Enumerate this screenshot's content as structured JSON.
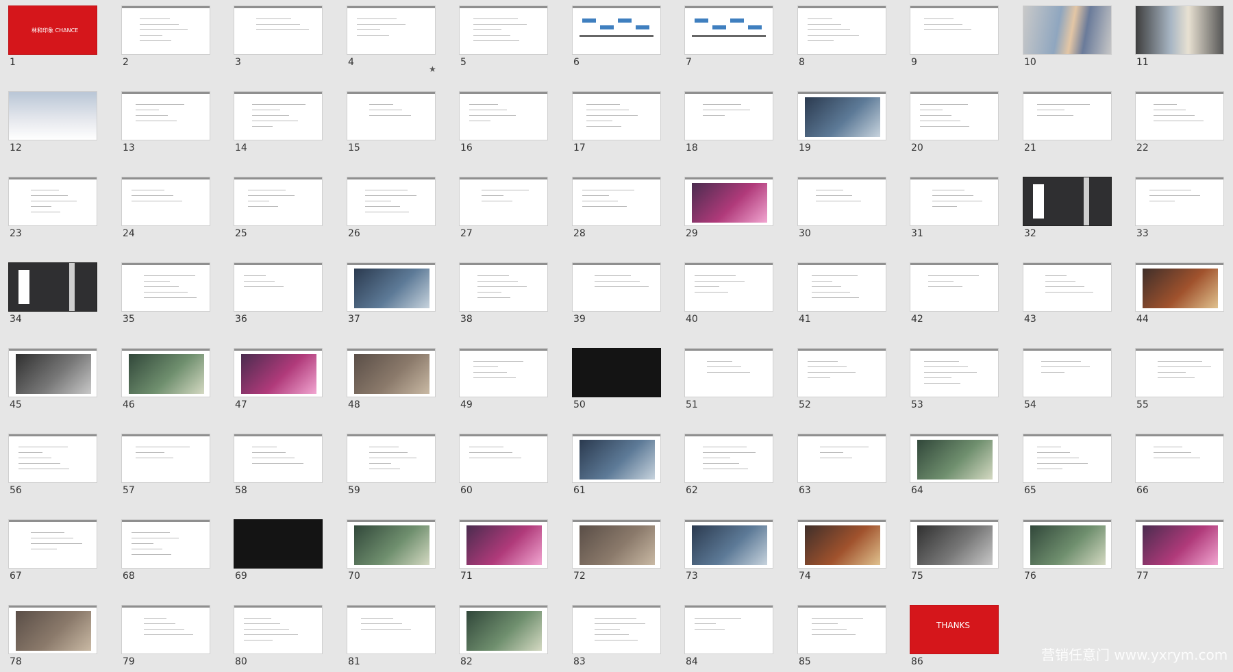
{
  "slides": [
    {
      "n": "1",
      "style": "red",
      "text": "林和印象 CHANCE"
    },
    {
      "n": "2",
      "style": "plain"
    },
    {
      "n": "3",
      "style": "plain"
    },
    {
      "n": "4",
      "style": "plain",
      "starred": true
    },
    {
      "n": "5",
      "style": "plain"
    },
    {
      "n": "6",
      "style": "chart"
    },
    {
      "n": "7",
      "style": "chart"
    },
    {
      "n": "8",
      "style": "plain"
    },
    {
      "n": "9",
      "style": "plain"
    },
    {
      "n": "10",
      "style": "grad"
    },
    {
      "n": "11",
      "style": "grad2"
    },
    {
      "n": "12",
      "style": "sky"
    },
    {
      "n": "13",
      "style": "plain"
    },
    {
      "n": "14",
      "style": "plain"
    },
    {
      "n": "15",
      "style": "plain"
    },
    {
      "n": "16",
      "style": "plain"
    },
    {
      "n": "17",
      "style": "plain"
    },
    {
      "n": "18",
      "style": "plain"
    },
    {
      "n": "19",
      "style": "photo"
    },
    {
      "n": "20",
      "style": "plain"
    },
    {
      "n": "21",
      "style": "plain"
    },
    {
      "n": "22",
      "style": "plain"
    },
    {
      "n": "23",
      "style": "plain"
    },
    {
      "n": "24",
      "style": "plain"
    },
    {
      "n": "25",
      "style": "plain"
    },
    {
      "n": "26",
      "style": "plain"
    },
    {
      "n": "27",
      "style": "plain"
    },
    {
      "n": "28",
      "style": "plain"
    },
    {
      "n": "29",
      "style": "photo"
    },
    {
      "n": "30",
      "style": "plain"
    },
    {
      "n": "31",
      "style": "plain"
    },
    {
      "n": "32",
      "style": "charcoal"
    },
    {
      "n": "33",
      "style": "plain"
    },
    {
      "n": "34",
      "style": "charcoal"
    },
    {
      "n": "35",
      "style": "plain"
    },
    {
      "n": "36",
      "style": "plain"
    },
    {
      "n": "37",
      "style": "photo"
    },
    {
      "n": "38",
      "style": "plain"
    },
    {
      "n": "39",
      "style": "plain"
    },
    {
      "n": "40",
      "style": "plain"
    },
    {
      "n": "41",
      "style": "plain"
    },
    {
      "n": "42",
      "style": "plain"
    },
    {
      "n": "43",
      "style": "plain"
    },
    {
      "n": "44",
      "style": "photo"
    },
    {
      "n": "45",
      "style": "photo"
    },
    {
      "n": "46",
      "style": "photo"
    },
    {
      "n": "47",
      "style": "photo"
    },
    {
      "n": "48",
      "style": "photo"
    },
    {
      "n": "49",
      "style": "plain"
    },
    {
      "n": "50",
      "style": "dark"
    },
    {
      "n": "51",
      "style": "plain"
    },
    {
      "n": "52",
      "style": "plain"
    },
    {
      "n": "53",
      "style": "plain"
    },
    {
      "n": "54",
      "style": "plain"
    },
    {
      "n": "55",
      "style": "plain"
    },
    {
      "n": "56",
      "style": "plain"
    },
    {
      "n": "57",
      "style": "plain"
    },
    {
      "n": "58",
      "style": "plain"
    },
    {
      "n": "59",
      "style": "plain"
    },
    {
      "n": "60",
      "style": "plain"
    },
    {
      "n": "61",
      "style": "photo"
    },
    {
      "n": "62",
      "style": "plain"
    },
    {
      "n": "63",
      "style": "plain"
    },
    {
      "n": "64",
      "style": "photo"
    },
    {
      "n": "65",
      "style": "plain"
    },
    {
      "n": "66",
      "style": "plain"
    },
    {
      "n": "67",
      "style": "plain"
    },
    {
      "n": "68",
      "style": "plain"
    },
    {
      "n": "69",
      "style": "dark"
    },
    {
      "n": "70",
      "style": "photo"
    },
    {
      "n": "71",
      "style": "photo"
    },
    {
      "n": "72",
      "style": "photo"
    },
    {
      "n": "73",
      "style": "photo"
    },
    {
      "n": "74",
      "style": "photo"
    },
    {
      "n": "75",
      "style": "photo"
    },
    {
      "n": "76",
      "style": "photo"
    },
    {
      "n": "77",
      "style": "photo"
    },
    {
      "n": "78",
      "style": "photo"
    },
    {
      "n": "79",
      "style": "plain"
    },
    {
      "n": "80",
      "style": "plain"
    },
    {
      "n": "81",
      "style": "plain"
    },
    {
      "n": "82",
      "style": "photo"
    },
    {
      "n": "83",
      "style": "plain"
    },
    {
      "n": "84",
      "style": "plain"
    },
    {
      "n": "85",
      "style": "plain"
    },
    {
      "n": "86",
      "style": "red",
      "text": "THANKS"
    }
  ],
  "watermark": "营销任意门 www.yxrym.com",
  "colors": {
    "background": "#e6e6e6",
    "accent_red": "#d5161b"
  }
}
